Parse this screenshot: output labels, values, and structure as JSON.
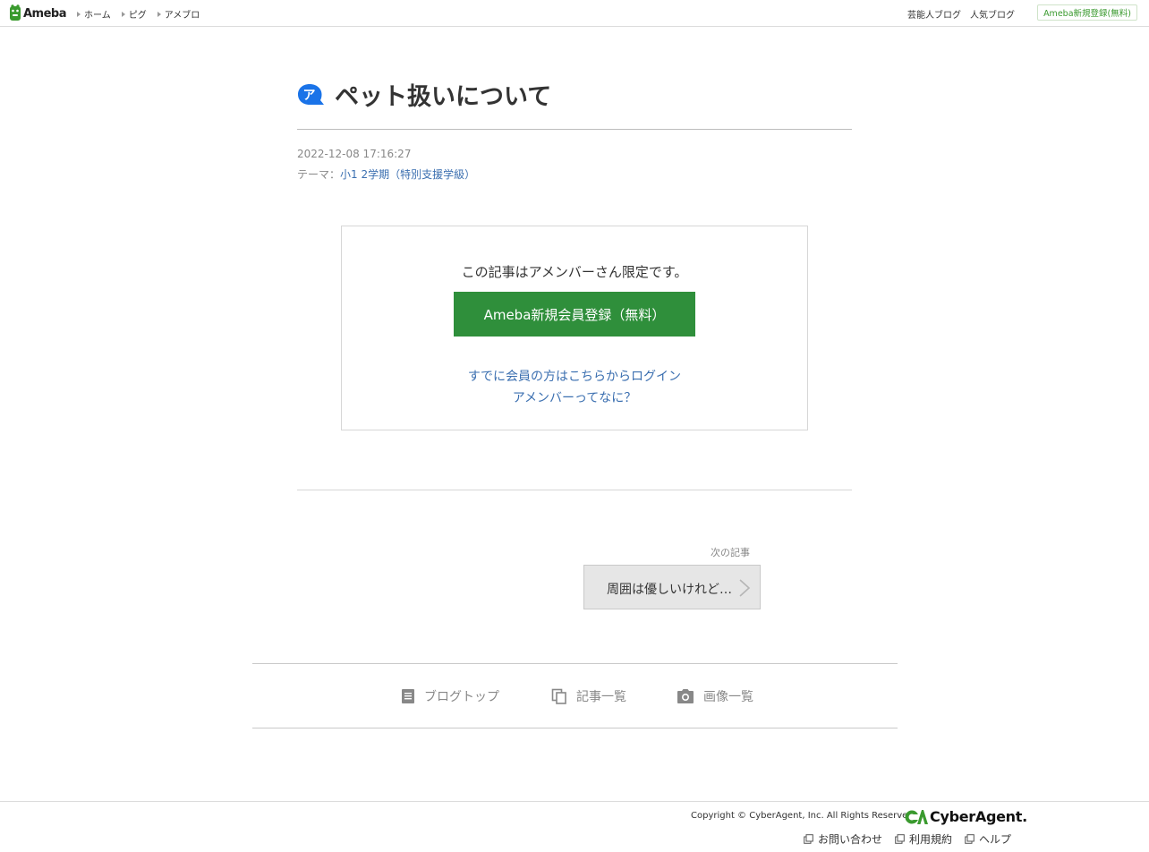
{
  "header": {
    "logo_text": "Ameba",
    "nav": [
      {
        "label": "ホーム"
      },
      {
        "label": "ピグ"
      },
      {
        "label": "アメブロ"
      }
    ],
    "right_links": [
      {
        "label": "芸能人ブログ"
      },
      {
        "label": "人気ブログ"
      }
    ],
    "signup_label": "Ameba新規登録(無料)"
  },
  "article": {
    "title": "ペット扱いについて",
    "date": "2022-12-08 17:16:27",
    "theme_prefix": "テーマ：",
    "theme_name": "小1 2学期（特別支援学級）"
  },
  "member_box": {
    "message": "この記事はアメンバーさん限定です。",
    "signup_button": "Ameba新規会員登録（無料）",
    "login_link": "すでに会員の方はこちらからログイン",
    "what_link": "アメンバーってなに？"
  },
  "next_article": {
    "label": "次の記事",
    "title": "周囲は優しいけれど…"
  },
  "blog_nav": [
    {
      "label": "ブログトップ",
      "icon": "document-icon"
    },
    {
      "label": "記事一覧",
      "icon": "copy-icon"
    },
    {
      "label": "画像一覧",
      "icon": "camera-icon"
    }
  ],
  "footer": {
    "copyright": "Copyright © CyberAgent, Inc. All Rights Reserved.",
    "company_logo_text": "CyberAgent.",
    "links": [
      {
        "label": "お問い合わせ"
      },
      {
        "label": "利用規約"
      },
      {
        "label": "ヘルプ"
      }
    ]
  },
  "colors": {
    "accent_green": "#2f8f3b",
    "link_blue": "#3b6fb0",
    "amember_blue": "#1a73e8"
  }
}
